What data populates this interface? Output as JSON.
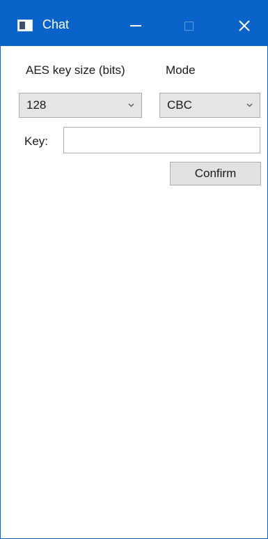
{
  "window": {
    "title": "Chat",
    "accent_color": "#0a63c9",
    "controls": {
      "minimize_icon": "minimize-icon",
      "maximize_icon": "maximize-icon",
      "close_icon": "close-icon"
    }
  },
  "form": {
    "key_size": {
      "label": "AES key size (bits)",
      "selected": "128"
    },
    "mode": {
      "label": "Mode",
      "selected": "CBC"
    },
    "key": {
      "label": "Key:",
      "value": ""
    },
    "confirm_label": "Confirm"
  }
}
